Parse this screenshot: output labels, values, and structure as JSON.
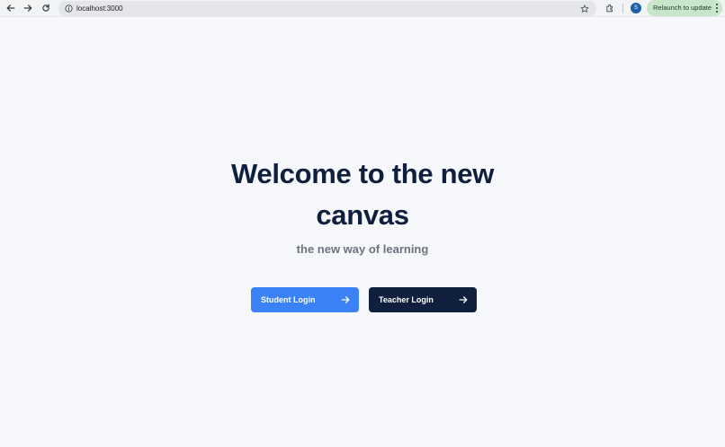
{
  "browser": {
    "url": "localhost:3000",
    "profile_initial": "S",
    "relaunch_label": "Relaunch to update",
    "accent_colors": {
      "toolbar": "#f1f3f4",
      "omnibox": "#e4e6ea",
      "relaunch": "#c8e6c9",
      "avatar": "#1a5fa8"
    }
  },
  "hero": {
    "title": "Welcome to the new canvas",
    "subtitle": "the new way of learning"
  },
  "actions": {
    "student_label": "Student Login",
    "teacher_label": "Teacher Login",
    "student_color": "#3b82f6",
    "teacher_color": "#0f1f3d"
  },
  "icons": {
    "back": "arrow-left-icon",
    "forward": "arrow-right-icon",
    "reload": "reload-icon",
    "site_info": "info-icon",
    "bookmark": "star-icon",
    "extensions": "puzzle-icon",
    "menu": "kebab-menu-icon",
    "button_arrow": "arrow-right-icon"
  }
}
